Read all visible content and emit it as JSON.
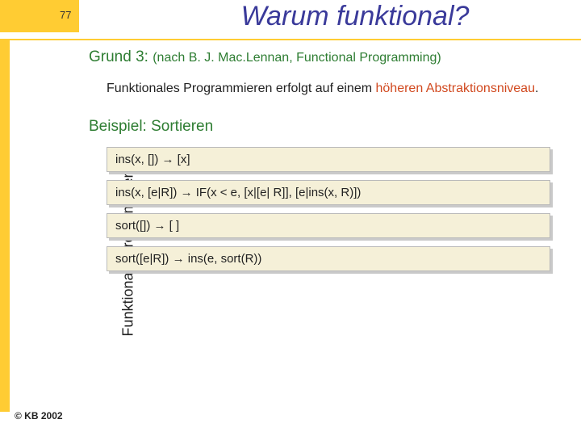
{
  "page_number": "77",
  "title": "Warum funktional?",
  "sidebar_label": "Funktionale Programmierung",
  "copyright": "© KB 2002",
  "grund_label": "Grund 3:",
  "grund_sub": "(nach B. J. Mac.Lennan, Functional Programming)",
  "body_pre": "Funktionales Programmieren erfolgt auf einem ",
  "body_hot": "höheren Abstraktionsniveau",
  "body_post": ".",
  "section": "Beispiel: Sortieren",
  "code": [
    "ins(x, []) → [x]",
    "ins(x, [e|R]) → IF(x < e, [x|[e| R]], [e|ins(x, R)])",
    "sort([]) → [ ]",
    "sort([e|R]) → ins(e, sort(R))"
  ]
}
